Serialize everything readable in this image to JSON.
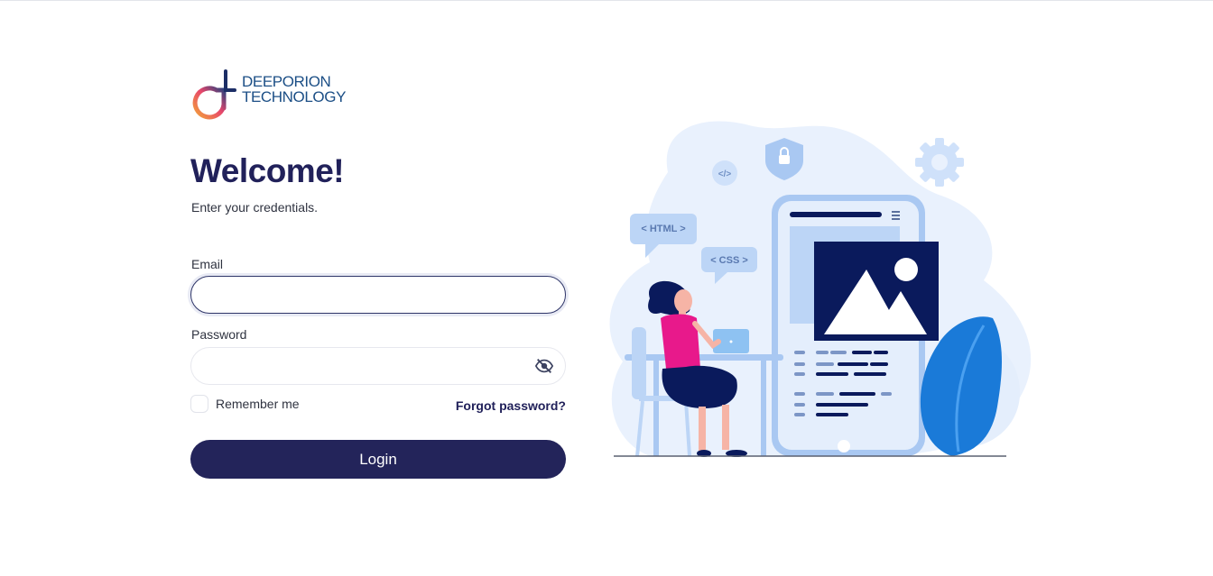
{
  "brand": {
    "line1": "DEEPORION",
    "line2": "TECHNOLOGY",
    "icon": "brand-logo-icon"
  },
  "header": {
    "title": "Welcome!",
    "subtitle": "Enter your credentials."
  },
  "form": {
    "email_label": "Email",
    "email_value": "",
    "password_label": "Password",
    "password_value": "",
    "eye_icon": "eye-off-icon",
    "remember_label": "Remember me",
    "forgot_label": "Forgot password?",
    "login_label": "Login"
  },
  "illustration": {
    "html_tag": "< HTML >",
    "css_tag": "< CSS >",
    "code_tag": "</>"
  },
  "colors": {
    "primary": "#23245a",
    "brand_text": "#1c4f86",
    "illustration_light": "#e9f1fd",
    "illustration_mid": "#a9c8f2",
    "illustration_dark": "#0a1a5c",
    "accent_pink": "#e8198b"
  }
}
